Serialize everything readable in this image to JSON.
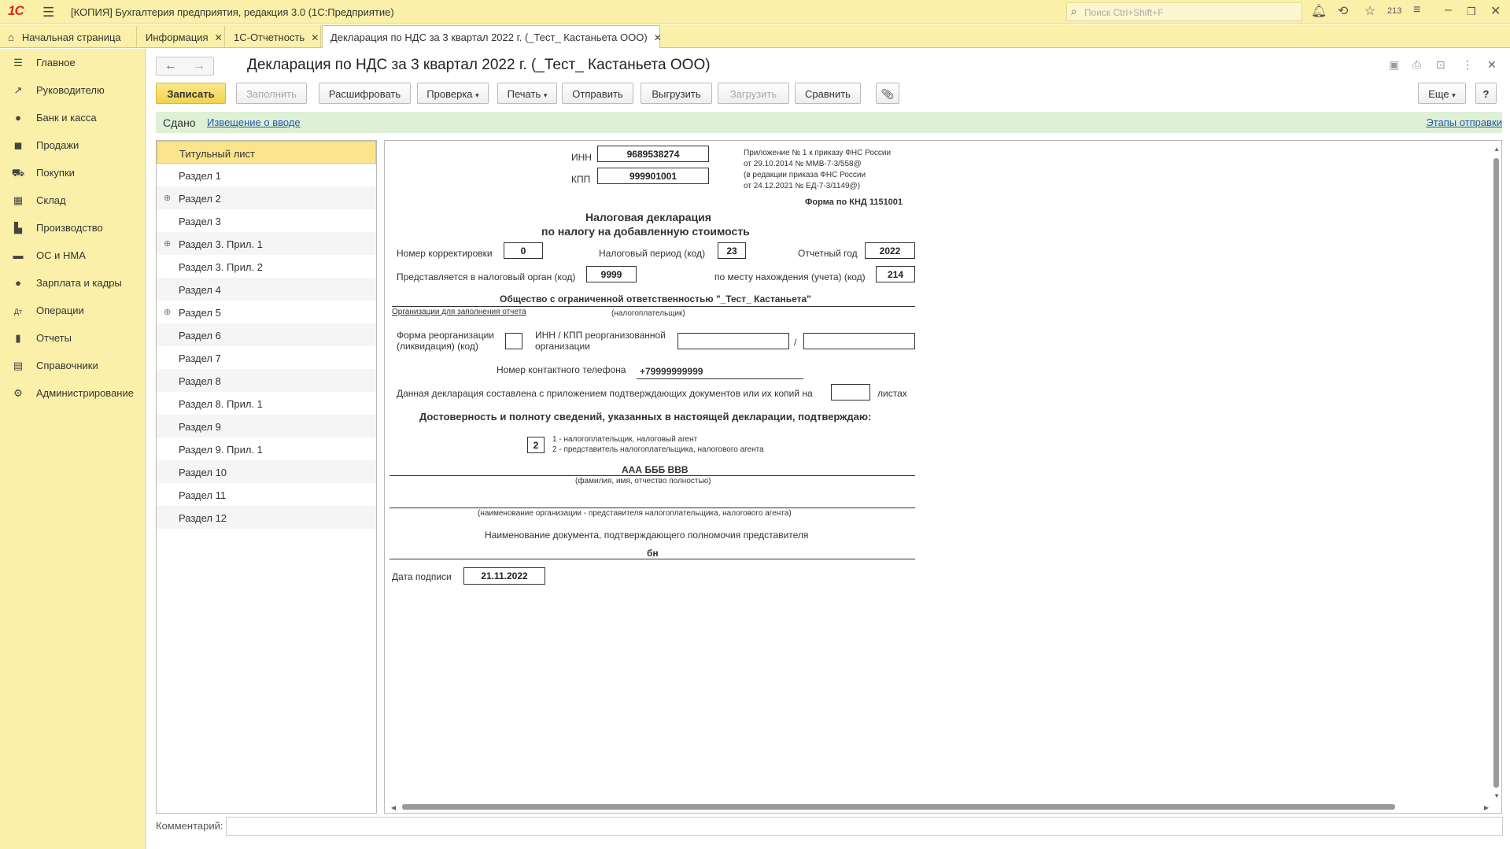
{
  "app": {
    "title": "[КОПИЯ] Бухгалтерия предприятия, редакция 3.0  (1С:Предприятие)",
    "logo": "1С",
    "search_placeholder": "Поиск Ctrl+Shift+F",
    "notifications_count": "213"
  },
  "tabs": [
    {
      "label": "Начальная страница"
    },
    {
      "label": "Информация"
    },
    {
      "label": "1С-Отчетность"
    },
    {
      "label": "Декларация по НДС за 3 квартал 2022 г. (_Тест_ Кастаньета ООО)"
    }
  ],
  "sidebar": {
    "items": [
      {
        "label": "Главное",
        "icon": "list-icon"
      },
      {
        "label": "Руководителю",
        "icon": "trend-icon"
      },
      {
        "label": "Банк и касса",
        "icon": "bank-icon"
      },
      {
        "label": "Продажи",
        "icon": "bag-icon"
      },
      {
        "label": "Покупки",
        "icon": "cart-icon"
      },
      {
        "label": "Склад",
        "icon": "warehouse-icon"
      },
      {
        "label": "Производство",
        "icon": "factory-icon"
      },
      {
        "label": "ОС и НМА",
        "icon": "truck-icon"
      },
      {
        "label": "Зарплата и кадры",
        "icon": "person-icon"
      },
      {
        "label": "Операции",
        "icon": "operations-icon"
      },
      {
        "label": "Отчеты",
        "icon": "chart-icon"
      },
      {
        "label": "Справочники",
        "icon": "book-icon"
      },
      {
        "label": "Администрирование",
        "icon": "gear-icon"
      }
    ]
  },
  "document": {
    "title": "Декларация по НДС за 3 квартал 2022 г. (_Тест_ Кастаньета ООО)"
  },
  "toolbar": {
    "save": "Записать",
    "fill": "Заполнить",
    "decode": "Расшифровать",
    "check": "Проверка",
    "print": "Печать",
    "send": "Отправить",
    "export": "Выгрузить",
    "import": "Загрузить",
    "compare": "Сравнить",
    "more": "Еще",
    "help": "?"
  },
  "status": {
    "state": "Сдано",
    "notice_link": "Извещение о вводе",
    "stages_link": "Этапы отправки"
  },
  "sections": [
    {
      "label": "Титульный лист",
      "expandable": false
    },
    {
      "label": "Раздел 1",
      "expandable": false
    },
    {
      "label": "Раздел 2",
      "expandable": true
    },
    {
      "label": "Раздел 3",
      "expandable": false
    },
    {
      "label": "Раздел 3. Прил. 1",
      "expandable": true
    },
    {
      "label": "Раздел 3. Прил. 2",
      "expandable": false
    },
    {
      "label": "Раздел 4",
      "expandable": false
    },
    {
      "label": "Раздел 5",
      "expandable": true
    },
    {
      "label": "Раздел 6",
      "expandable": false
    },
    {
      "label": "Раздел 7",
      "expandable": false
    },
    {
      "label": "Раздел 8",
      "expandable": false
    },
    {
      "label": "Раздел 8. Прил. 1",
      "expandable": false
    },
    {
      "label": "Раздел 9",
      "expandable": false
    },
    {
      "label": "Раздел 9. Прил. 1",
      "expandable": false
    },
    {
      "label": "Раздел 10",
      "expandable": false
    },
    {
      "label": "Раздел 11",
      "expandable": false
    },
    {
      "label": "Раздел 12",
      "expandable": false
    }
  ],
  "form": {
    "inn_label": "ИНН",
    "inn": "9689538274",
    "kpp_label": "КПП",
    "kpp": "999901001",
    "appendix_lines": [
      "Приложение № 1 к приказу ФНС России",
      "от 29.10.2014 № ММВ-7-3/558@",
      "(в редакции приказа ФНС России",
      "от 24.12.2021 № ЕД-7-3/1149@)"
    ],
    "knd": "Форма по КНД 1151001",
    "title_line1": "Налоговая декларация",
    "title_line2": "по налогу на добавленную стоимость",
    "correction_label": "Номер корректировки",
    "correction": "0",
    "period_label": "Налоговый период (код)",
    "period": "23",
    "year_label": "Отчетный год",
    "year": "2022",
    "authority_label": "Представляется в налоговый орган (код)",
    "authority": "9999",
    "location_label": "по месту нахождения (учета) (код)",
    "location": "214",
    "org_name": "Общество с ограниченной ответственностью \"_Тест_ Кастаньета\"",
    "org_link": "Организации для заполнения отчета",
    "taxpayer_note": "(налогоплательщик)",
    "reorg_label1": "Форма реорганизации",
    "reorg_label2": "(ликвидация) (код)",
    "reorg_inn_label1": "ИНН / КПП реорганизованной",
    "reorg_inn_label2": "организации",
    "slash": "/",
    "phone_label": "Номер контактного телефона",
    "phone": "+79999999999",
    "pages_text": "Данная декларация составлена с приложением подтверждающих документов или их копий на",
    "pages_suffix": "листах",
    "confirm_title": "Достоверность и полноту сведений, указанных в настоящей декларации, подтверждаю:",
    "signer_code": "2",
    "signer_opt1": "1 - налогоплательщик, налоговый агент",
    "signer_opt2": "2 - представитель налогоплательщика, налогового агента",
    "signer_name": "ААА БББ ВВВ",
    "fio_note": "(фамилия, имя, отчество полностью)",
    "rep_org_note": "(наименование организации - представителя налогоплательщика, налогового агента)",
    "doc_label": "Наименование документа, подтверждающего полномочия представителя",
    "doc_value": "бн",
    "sign_date_label": "Дата подписи",
    "sign_date": "21.11.2022"
  },
  "comment": {
    "label": "Комментарий:",
    "value": ""
  }
}
